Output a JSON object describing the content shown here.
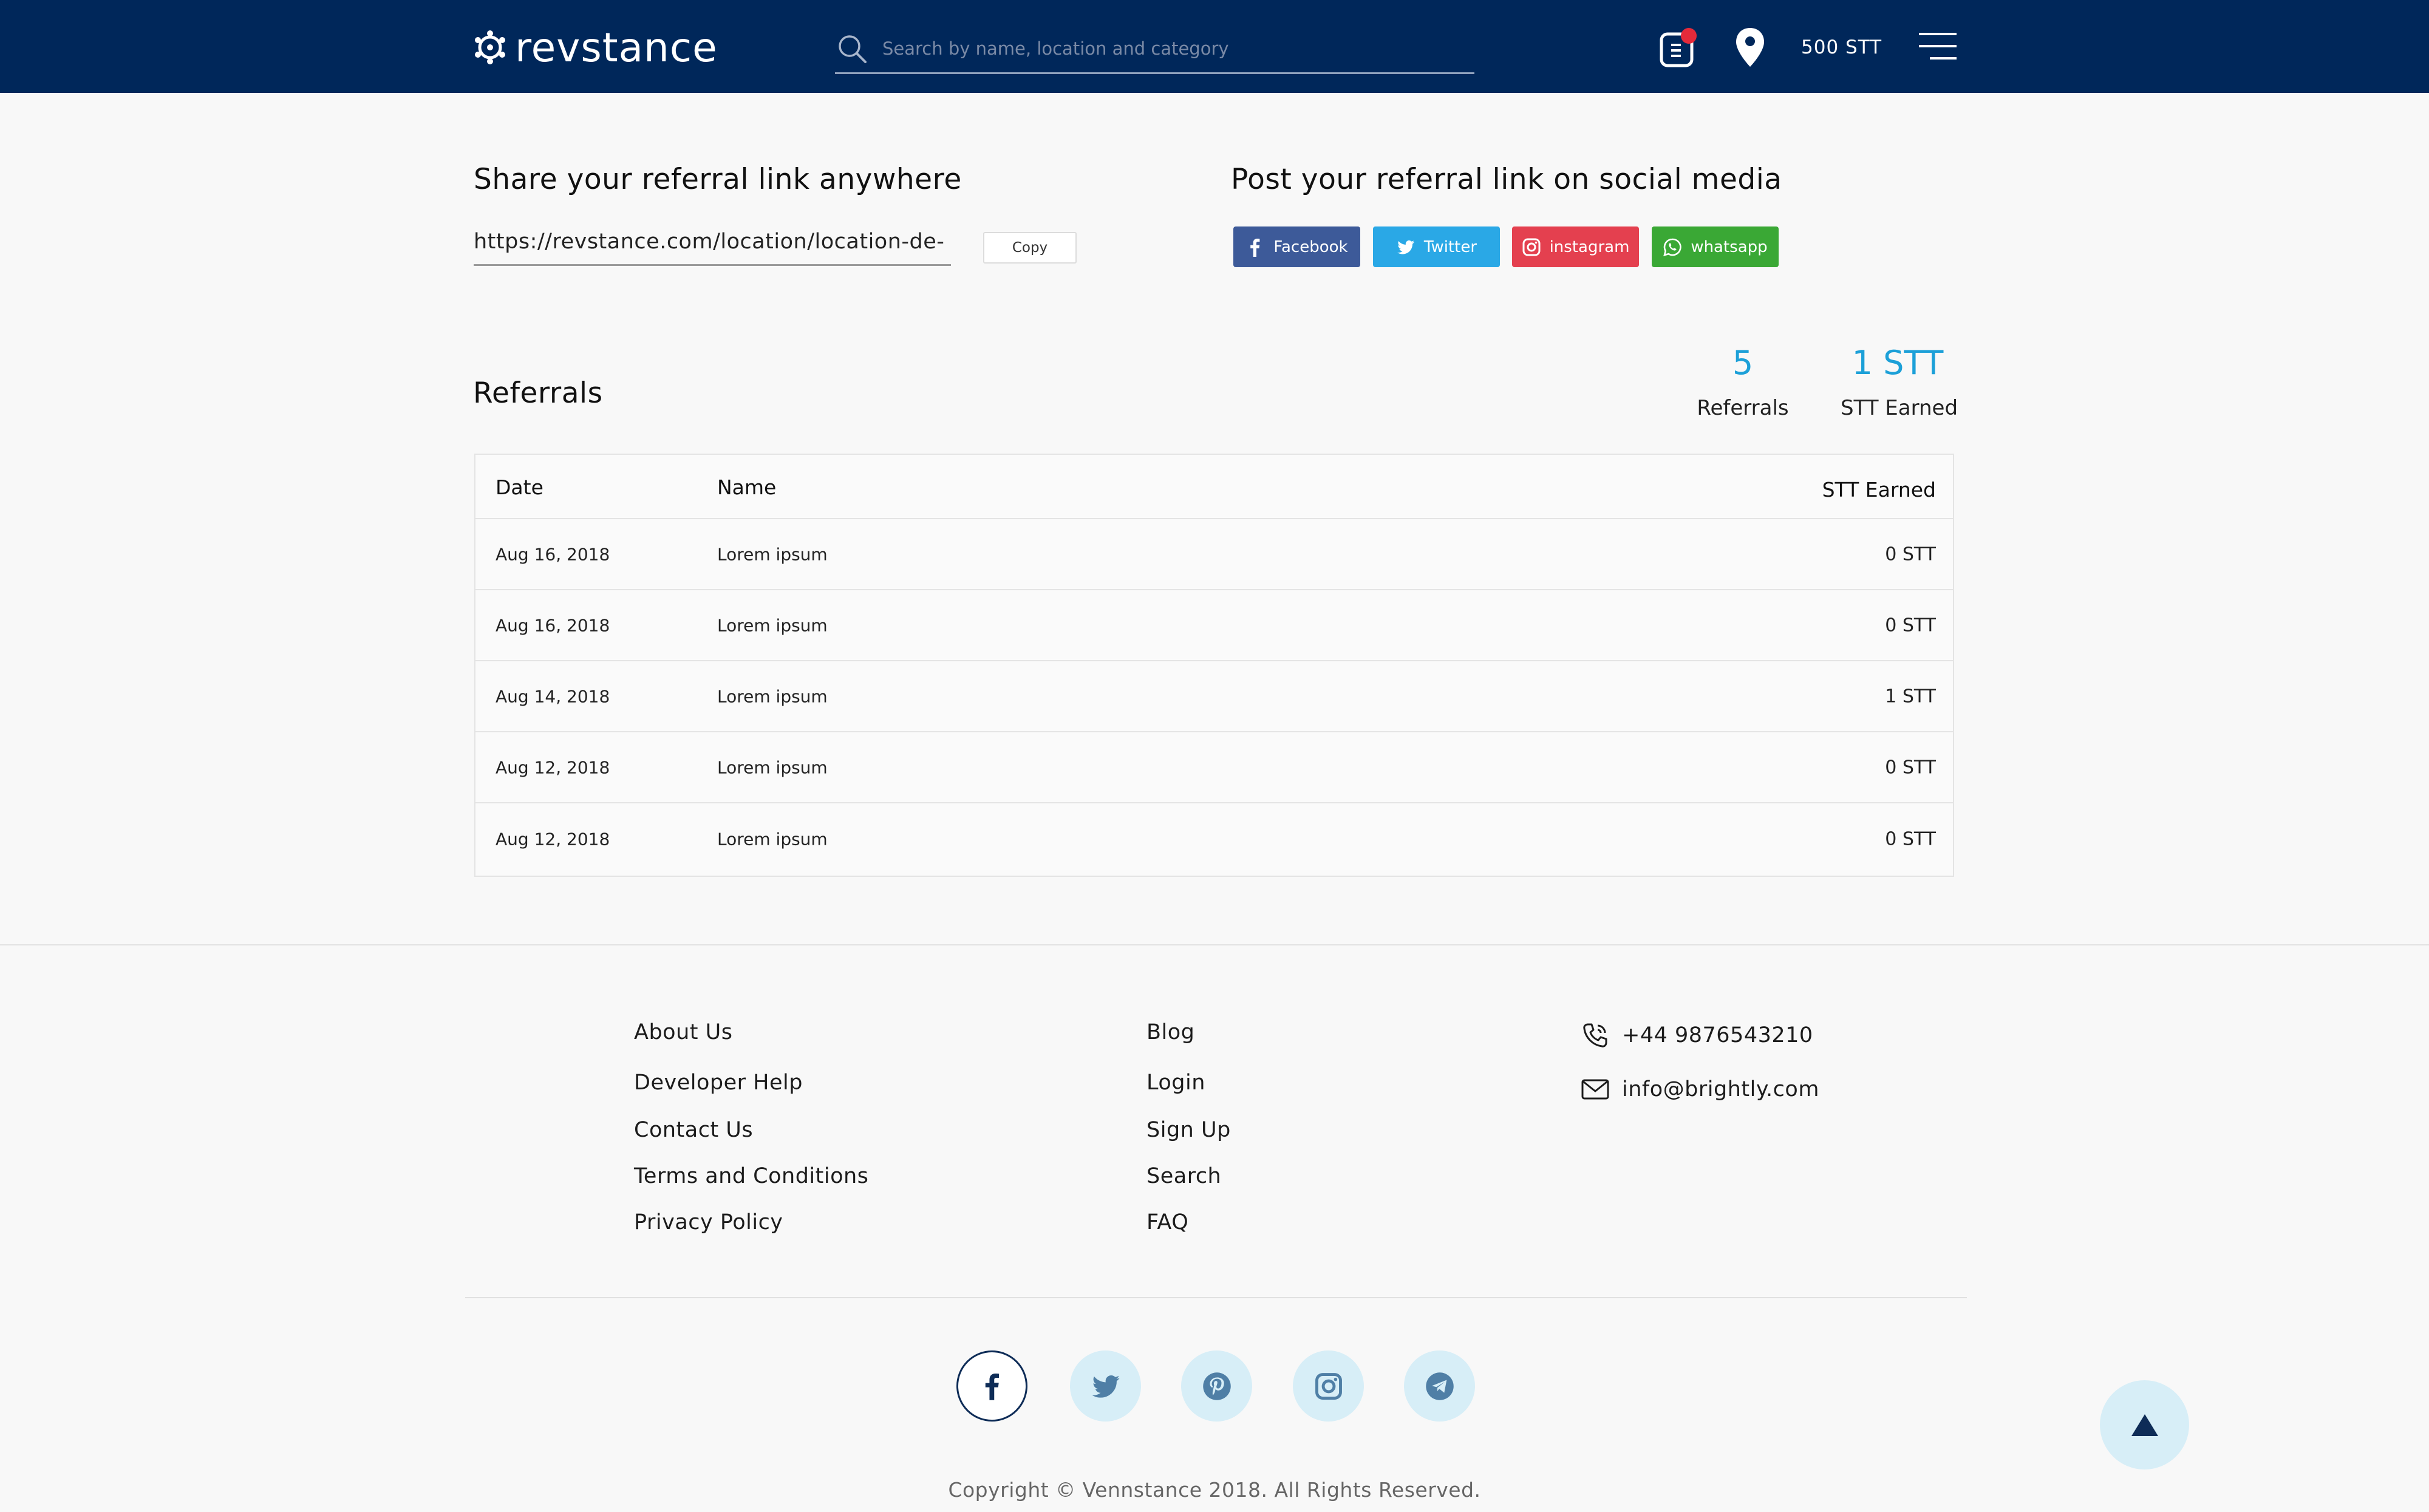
{
  "header": {
    "brand": "revstance",
    "search_placeholder": "Search by name, location and category",
    "balance": "500 STT"
  },
  "share": {
    "title": "Share your referral link anywhere",
    "link": "https://revstance.com/location/location-de-",
    "copy_label": "Copy"
  },
  "social_post": {
    "title": "Post your referral link on social media",
    "buttons": [
      {
        "label": "Facebook",
        "color": "#3d5a99",
        "icon": "facebook-icon"
      },
      {
        "label": "Twitter",
        "color": "#2aa8e6",
        "icon": "twitter-icon"
      },
      {
        "label": "instagram",
        "color": "#e4404f",
        "icon": "instagram-icon"
      },
      {
        "label": "whatsapp",
        "color": "#3aa835",
        "icon": "whatsapp-icon"
      }
    ]
  },
  "referrals": {
    "title": "Referrals",
    "stats": [
      {
        "value": "5",
        "label": "Referrals"
      },
      {
        "value": "1 STT",
        "label": "STT Earned"
      }
    ],
    "columns": [
      "Date",
      "Name",
      "STT Earned"
    ],
    "rows": [
      {
        "date": "Aug 16, 2018",
        "name": "Lorem ipsum",
        "stt": "0 STT"
      },
      {
        "date": "Aug 16, 2018",
        "name": "Lorem ipsum",
        "stt": "0 STT"
      },
      {
        "date": "Aug 14, 2018",
        "name": "Lorem ipsum",
        "stt": "1 STT"
      },
      {
        "date": "Aug 12, 2018",
        "name": "Lorem ipsum",
        "stt": "0 STT"
      },
      {
        "date": "Aug 12, 2018",
        "name": "Lorem ipsum",
        "stt": "0 STT"
      }
    ]
  },
  "footer": {
    "col1": [
      "About Us",
      "Developer Help",
      "Contact Us",
      "Terms and Conditions",
      "Privacy Policy"
    ],
    "col2": [
      "Blog",
      "Login",
      "Sign Up",
      "Search",
      "FAQ"
    ],
    "phone": "+44 9876543210",
    "email": "info@brightly.com",
    "social_icons": [
      "facebook-icon",
      "twitter-icon",
      "pinterest-icon",
      "instagram-icon",
      "telegram-icon"
    ],
    "copyright": "Copyright © Vennstance 2018. All Rights Reserved."
  },
  "colors": {
    "header_bg": "#00275a",
    "accent": "#1ca0d8",
    "notification": "#e52a3a"
  }
}
